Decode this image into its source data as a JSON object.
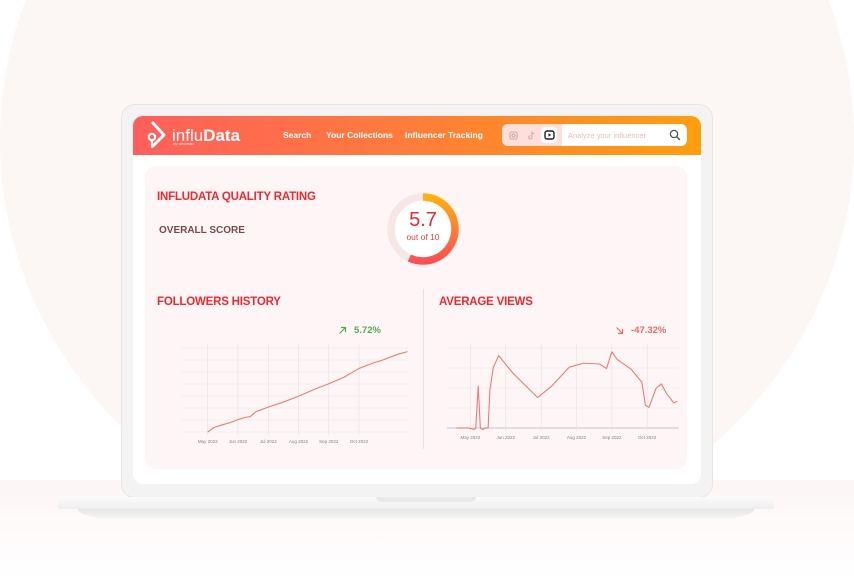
{
  "app": {
    "brand": "influData",
    "brand_prefix": "influ",
    "brand_suffix": "Data",
    "brand_sub": "by wecreate"
  },
  "nav": {
    "items": [
      {
        "label": "Search"
      },
      {
        "label": "Your Collections"
      },
      {
        "label": "Influencer Tracking"
      }
    ]
  },
  "search": {
    "placeholder": "Analyze your influencer",
    "platforms": [
      {
        "name": "instagram",
        "icon": "instagram-icon",
        "active": false
      },
      {
        "name": "tiktok",
        "icon": "tiktok-icon",
        "active": false
      },
      {
        "name": "youtube",
        "icon": "youtube-icon",
        "active": true
      }
    ],
    "search_icon": "search-icon"
  },
  "colors": {
    "accent_red": "#f0292e",
    "gradient_start": "#ff5e5b",
    "gradient_end": "#ff9e0b",
    "positive": "#4caf50",
    "negative": "#f26a5e",
    "line": "#f27a72"
  },
  "quality": {
    "title": "INFLUDATA QUALITY RATING",
    "overall_label": "OVERALL SCORE",
    "score": "5.7",
    "score_value": 5.7,
    "score_max": 10,
    "score_sub": "out of 10"
  },
  "followers": {
    "title": "FOLLOWERS HISTORY",
    "change": "5.72%",
    "trend": "up"
  },
  "views": {
    "title": "AVERAGE VIEWS",
    "change": "-47.32%",
    "trend": "down"
  },
  "chart_data": [
    {
      "type": "line",
      "title": "FOLLOWERS HISTORY",
      "xlabel": "",
      "ylabel": "",
      "grid": true,
      "x_ticks": [
        "May 2022",
        "Jun 2022",
        "Jul 2022",
        "Aug 2022",
        "Sep 2022",
        "Oct 2022"
      ],
      "x": [
        0,
        0.2,
        0.5,
        0.75,
        1.0,
        1.25,
        1.4,
        1.6,
        2.0,
        2.5,
        3.0,
        3.5,
        4.0,
        4.5,
        5.0,
        5.25,
        5.5,
        5.75,
        6.0,
        6.25,
        6.6
      ],
      "values": [
        0.0,
        0.06,
        0.1,
        0.13,
        0.17,
        0.2,
        0.21,
        0.28,
        0.34,
        0.41,
        0.49,
        0.58,
        0.66,
        0.75,
        0.87,
        0.91,
        0.95,
        0.98,
        1.02,
        1.06,
        1.1
      ],
      "ylim": [
        0,
        1.15
      ],
      "note": "normalized values; y-axis unlabeled"
    },
    {
      "type": "line",
      "title": "AVERAGE VIEWS",
      "xlabel": "",
      "ylabel": "",
      "grid": true,
      "x_ticks": [
        "May 2022",
        "Jun 2022",
        "Jul 2022",
        "Aug 2022",
        "Sep 2022",
        "Oct 2022"
      ],
      "x": [
        -0.4,
        -0.05,
        0.1,
        0.15,
        0.22,
        0.28,
        0.35,
        0.42,
        0.5,
        0.55,
        0.65,
        0.8,
        1.2,
        1.9,
        2.3,
        2.8,
        3.2,
        3.65,
        3.85,
        4.0,
        4.15,
        4.55,
        4.85,
        4.95,
        5.05,
        5.25,
        5.4,
        5.55,
        5.75,
        5.85
      ],
      "values": [
        0.0,
        0.0,
        -0.02,
        0.0,
        0.55,
        0.0,
        -0.02,
        0.0,
        0.0,
        0.5,
        0.8,
        0.95,
        0.72,
        0.4,
        0.55,
        0.8,
        0.85,
        0.84,
        0.78,
        1.0,
        0.9,
        0.77,
        0.6,
        0.3,
        0.27,
        0.52,
        0.58,
        0.45,
        0.33,
        0.35
      ],
      "ylim": [
        0,
        1.05
      ],
      "note": "normalized values; y-axis unlabeled"
    }
  ]
}
